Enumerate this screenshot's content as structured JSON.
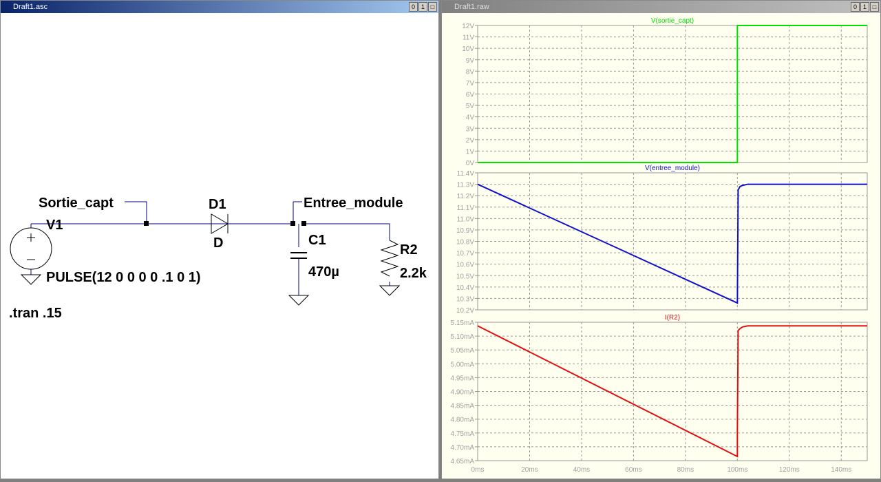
{
  "schematic_window": {
    "title": "Draft1.asc",
    "buttons": [
      "0",
      "1",
      "□"
    ]
  },
  "schematic": {
    "labels": {
      "sortie": "Sortie_capt",
      "entree": "Entree_module",
      "v1": "V1",
      "d1": "D1",
      "d_model": "D",
      "c1": "C1",
      "c1_value": "470µ",
      "r2": "R2",
      "r2_value": "2.2k",
      "pulse": "PULSE(12 0 0 0 0 .1 0 1)",
      "tran": ".tran .15"
    }
  },
  "waveform_window": {
    "title": "Draft1.raw",
    "buttons": [
      "0",
      "1",
      "□"
    ]
  },
  "colors": {
    "green": "#00e000",
    "blue": "#1010d0",
    "red": "#e01010",
    "plot_bg": "#fffff0",
    "grid": "#999999",
    "axis_text": "#a0a0a0"
  },
  "chart_data": [
    {
      "type": "line",
      "title": "V(sortie_capt)",
      "color": "green",
      "ylim": [
        0,
        12
      ],
      "yticks": [
        "0V",
        "1V",
        "2V",
        "3V",
        "4V",
        "5V",
        "6V",
        "7V",
        "8V",
        "9V",
        "10V",
        "11V",
        "12V"
      ],
      "ytick_values": [
        0,
        1,
        2,
        3,
        4,
        5,
        6,
        7,
        8,
        9,
        10,
        11,
        12
      ],
      "x": [
        0,
        100,
        100,
        150
      ],
      "y": [
        0,
        0,
        12,
        12
      ]
    },
    {
      "type": "line",
      "title": "V(entree_module)",
      "color": "blue",
      "ylim": [
        10.2,
        11.4
      ],
      "yticks": [
        "10.2V",
        "10.3V",
        "10.4V",
        "10.5V",
        "10.6V",
        "10.7V",
        "10.8V",
        "10.9V",
        "11.0V",
        "11.1V",
        "11.2V",
        "11.3V",
        "11.4V"
      ],
      "ytick_values": [
        10.2,
        10.3,
        10.4,
        10.5,
        10.6,
        10.7,
        10.8,
        10.9,
        11.0,
        11.1,
        11.2,
        11.3,
        11.4
      ],
      "x": [
        0,
        100,
        100.3,
        101,
        102,
        104,
        150
      ],
      "y": [
        11.3,
        10.26,
        11.25,
        11.28,
        11.29,
        11.3,
        11.3
      ]
    },
    {
      "type": "line",
      "title": "I(R2)",
      "color": "red",
      "ylim": [
        4.65,
        5.15
      ],
      "yticks": [
        "4.65mA",
        "4.70mA",
        "4.75mA",
        "4.80mA",
        "4.85mA",
        "4.90mA",
        "4.95mA",
        "5.00mA",
        "5.05mA",
        "5.10mA",
        "5.15mA"
      ],
      "ytick_values": [
        4.65,
        4.7,
        4.75,
        4.8,
        4.85,
        4.9,
        4.95,
        5.0,
        5.05,
        5.1,
        5.15
      ],
      "x": [
        0,
        100,
        100,
        100.3,
        101,
        102,
        104,
        150
      ],
      "y": [
        5.137,
        4.665,
        4.76,
        5.12,
        5.127,
        5.133,
        5.137,
        5.137
      ]
    }
  ],
  "x_axis": {
    "xlim": [
      0,
      150
    ],
    "ticks": [
      "0ms",
      "20ms",
      "40ms",
      "60ms",
      "80ms",
      "100ms",
      "120ms",
      "140ms"
    ],
    "tick_values": [
      0,
      20,
      40,
      60,
      80,
      100,
      120,
      140
    ]
  }
}
